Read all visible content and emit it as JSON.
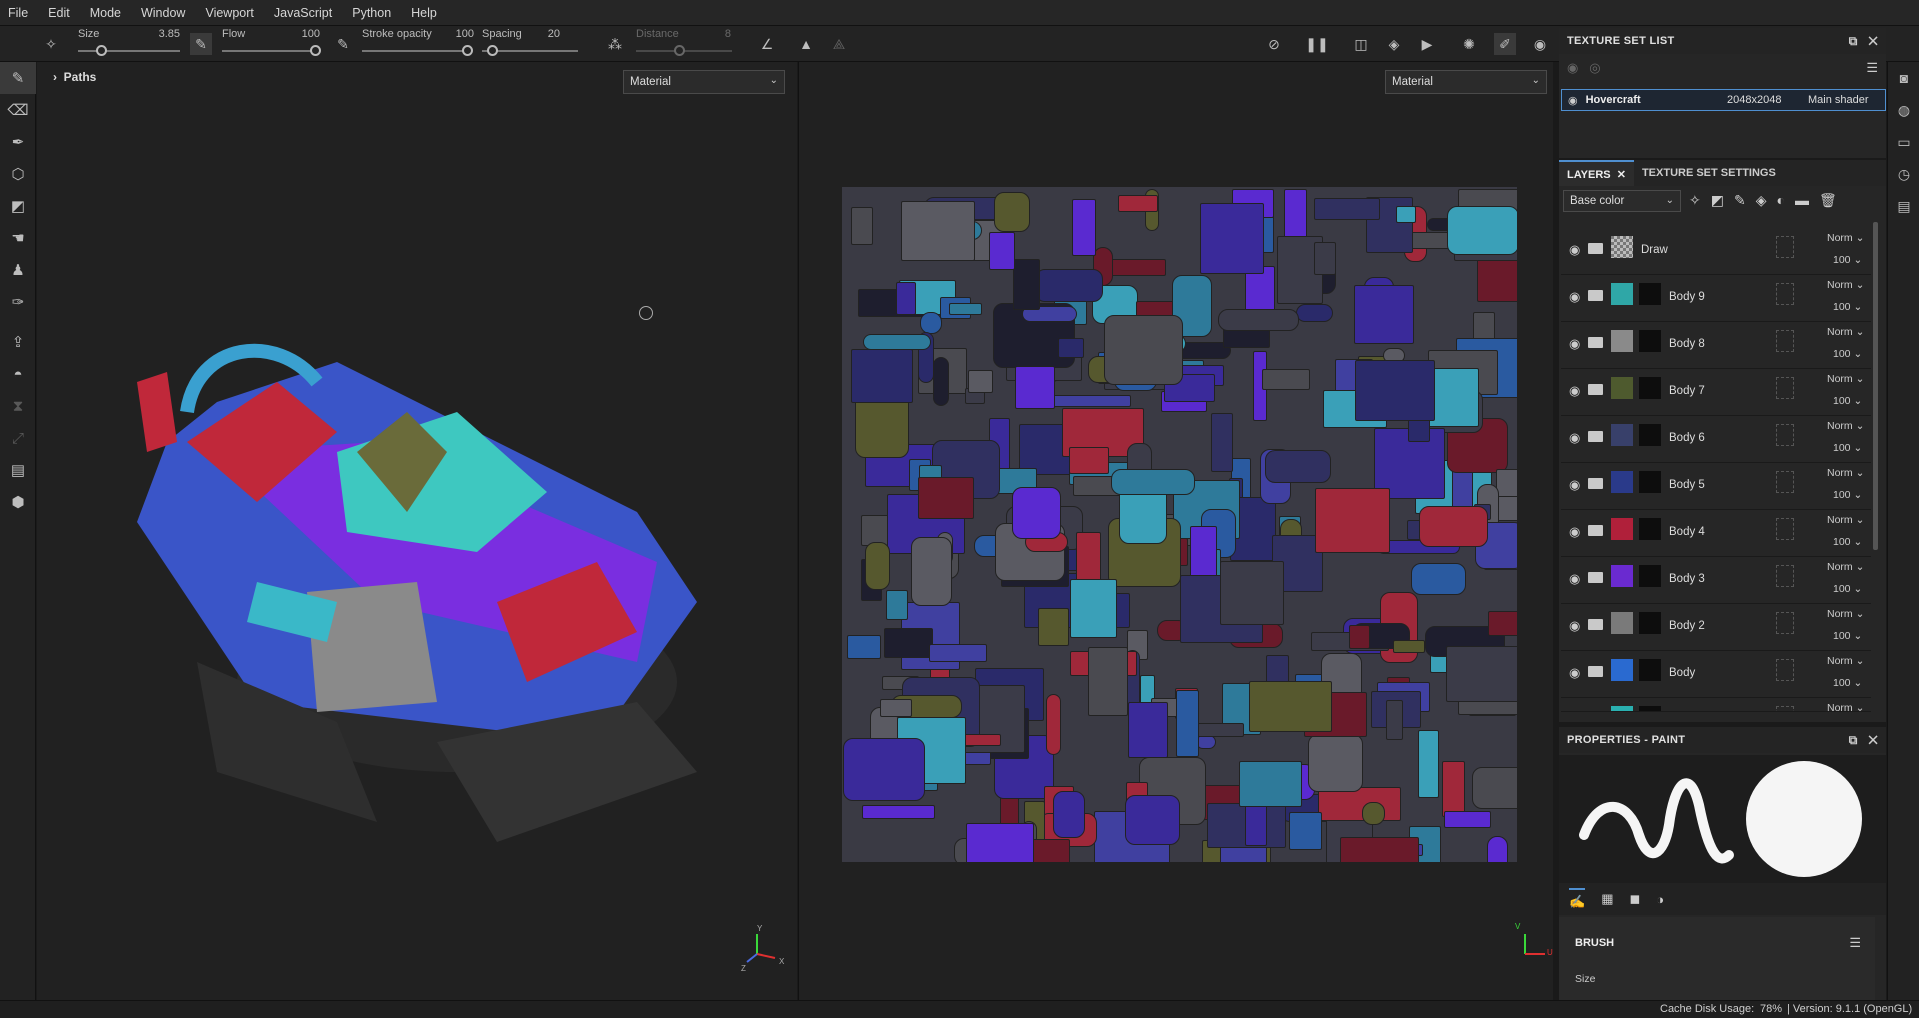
{
  "menu": [
    "File",
    "Edit",
    "Mode",
    "Window",
    "Viewport",
    "JavaScript",
    "Python",
    "Help"
  ],
  "toolbar": {
    "size_label": "Size",
    "size_value": "3.85",
    "flow_label": "Flow",
    "flow_value": "100",
    "stroke_label": "Stroke opacity",
    "stroke_value": "100",
    "spacing_label": "Spacing",
    "spacing_value": "20",
    "distance_label": "Distance",
    "distance_value": "8"
  },
  "viewport3d": {
    "paths_label": "Paths",
    "mode": "Material"
  },
  "viewport2d": {
    "mode": "Material"
  },
  "texture_set_list": {
    "title": "TEXTURE SET LIST",
    "item": {
      "name": "Hovercraft",
      "resolution": "2048x2048",
      "shader": "Main shader"
    }
  },
  "layers_panel": {
    "tab_layers": "LAYERS",
    "tab_settings": "TEXTURE SET SETTINGS",
    "channel": "Base color",
    "layers": [
      {
        "name": "Draw",
        "mode": "Norm",
        "opacity": "100",
        "color": "#888888"
      },
      {
        "name": "Body 9",
        "mode": "Norm",
        "opacity": "100",
        "color": "#2fa7a7"
      },
      {
        "name": "Body 8",
        "mode": "Norm",
        "opacity": "100",
        "color": "#8a8a8a"
      },
      {
        "name": "Body 7",
        "mode": "Norm",
        "opacity": "100",
        "color": "#4e5a2e"
      },
      {
        "name": "Body 6",
        "mode": "Norm",
        "opacity": "100",
        "color": "#38406a"
      },
      {
        "name": "Body 5",
        "mode": "Norm",
        "opacity": "100",
        "color": "#2a3a8a"
      },
      {
        "name": "Body 4",
        "mode": "Norm",
        "opacity": "100",
        "color": "#b0203a"
      },
      {
        "name": "Body 3",
        "mode": "Norm",
        "opacity": "100",
        "color": "#6a2ad0"
      },
      {
        "name": "Body 2",
        "mode": "Norm",
        "opacity": "100",
        "color": "#7a7a7a"
      },
      {
        "name": "Body",
        "mode": "Norm",
        "opacity": "100",
        "color": "#2a6ad0"
      },
      {
        "name": "",
        "mode": "Norm",
        "opacity": "",
        "color": "#2ab0b0"
      }
    ]
  },
  "properties": {
    "title": "PROPERTIES - PAINT",
    "section": "BRUSH",
    "size_label": "Size"
  },
  "status": {
    "cache_label": "Cache Disk Usage:",
    "cache_value": "78%",
    "version": "| Version: 9.1.1 (OpenGL)"
  },
  "axis": {
    "x": "X",
    "y": "Y",
    "z": "Z",
    "u": "U",
    "v": "V"
  }
}
